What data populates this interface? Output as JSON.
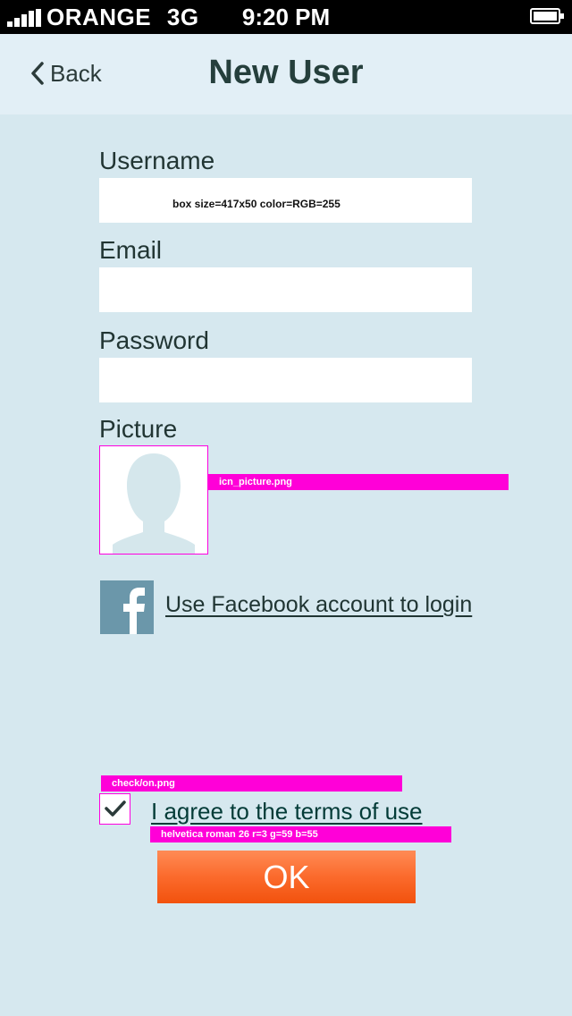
{
  "status_bar": {
    "carrier": "ORANGE",
    "network": "3G",
    "time": "9:20 PM"
  },
  "nav": {
    "back_label": "Back",
    "title": "New User"
  },
  "form": {
    "username_label": "Username",
    "username_value": "",
    "username_note": "box size=417x50 color=RGB=255",
    "email_label": "Email",
    "email_value": "",
    "password_label": "Password",
    "password_value": "",
    "picture_label": "Picture"
  },
  "annotations": {
    "picture": "icn_picture.png",
    "check": "check/on.png",
    "font": "helvetica roman 26 r=3 g=59 b=55"
  },
  "facebook": {
    "link_label": "Use Facebook account to login"
  },
  "terms": {
    "checked": true,
    "label": "I agree to the terms of use"
  },
  "submit": {
    "label": "OK"
  },
  "colors": {
    "background": "#d6e8ef",
    "nav_background": "#e2eff6",
    "annotation": "#ff00d8",
    "ok_button": "#fb6a2c",
    "terms_text": "#033b37"
  },
  "icons": [
    "signal-icon",
    "battery-icon",
    "chevron-left-icon",
    "avatar-placeholder-icon",
    "facebook-icon",
    "checkmark-icon"
  ]
}
